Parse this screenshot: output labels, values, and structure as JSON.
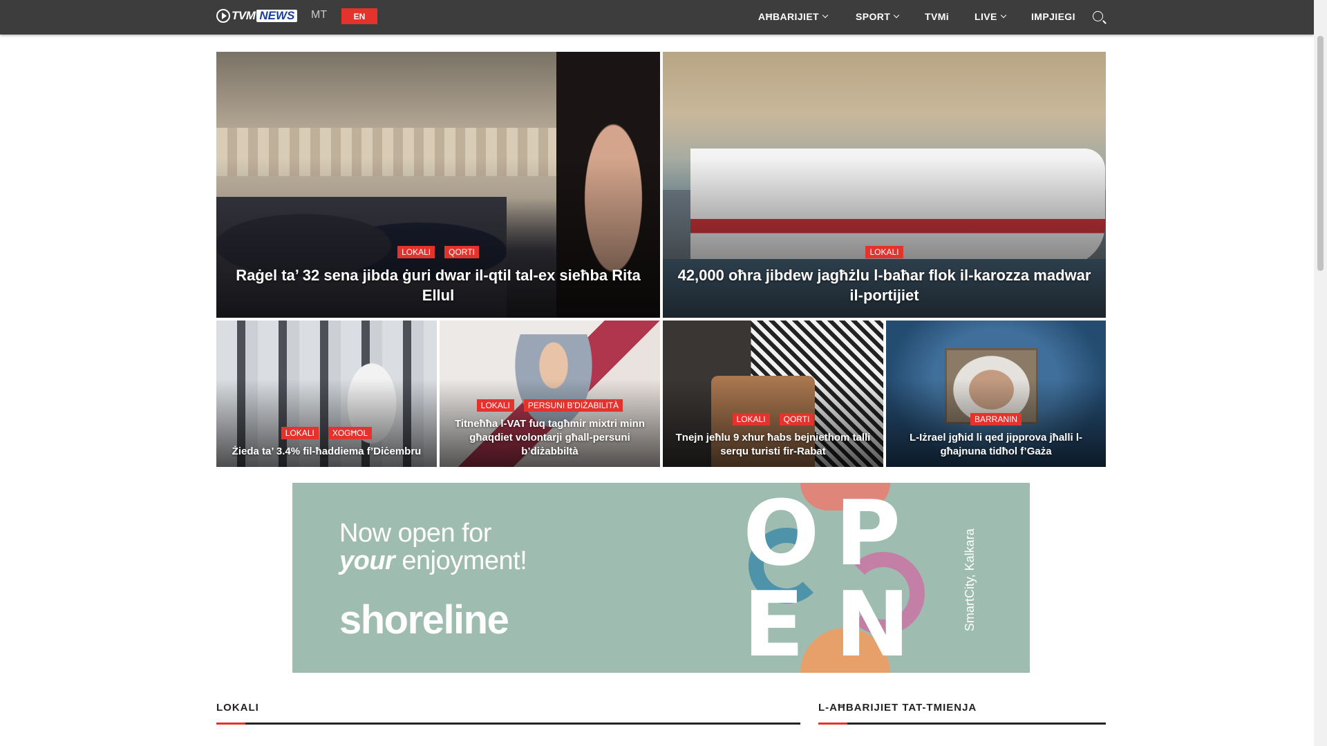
{
  "header": {
    "logo_tvm": "TVM",
    "logo_news": "NEWS",
    "logo_lang": "MT",
    "lang_button": "EN",
    "nav": [
      {
        "label": "AĦBARIJIET",
        "has_menu": true
      },
      {
        "label": "SPORT",
        "has_menu": true
      },
      {
        "label": "TVMi",
        "has_menu": false
      },
      {
        "label": "LIVE",
        "has_menu": true
      },
      {
        "label": "IMPJIEGI",
        "has_menu": false
      }
    ],
    "search_icon": "search-icon"
  },
  "featured": [
    {
      "tags": [
        "LOKALI",
        "QORTI"
      ],
      "title": "Raġel ta’ 32 sena jibda ġuri dwar il-qtil tal-ex sieħba Rita Ellul"
    },
    {
      "tags": [
        "LOKALI"
      ],
      "title": "42,000 oħra jibdew jagħżlu l-baħar flok il-karozza madwar il-portijiet"
    },
    {
      "tags": [
        "LOKALI",
        "XOGĦOL"
      ],
      "title": "Żieda ta’ 3.4% fil-ħaddiema f’Diċembru"
    },
    {
      "tags": [
        "LOKALI",
        "PERSUNI B’DIŻABILITÀ"
      ],
      "title": "Titneħħa l-VAT fuq tagħmir mixtri minn għaqdiet volontarji għall-persuni b’diżabbiltà"
    },
    {
      "tags": [
        "LOKALI",
        "QORTI"
      ],
      "title": "Tnejn jeħlu 9 xhur ħabs bejniethom talli serqu turisti fir-Rabat"
    },
    {
      "tags": [
        "BARRANIN"
      ],
      "title": "L-Iżrael jgħid li qed jipprova jħalli l-għajnuna tidħol f’Gaża"
    }
  ],
  "banner": {
    "line1": "Now open for",
    "line2_bold": "your",
    "line2_rest": " enjoyment!",
    "brand": "shoreline",
    "location": "SmartCity, Kalkara",
    "word": "OPEN"
  },
  "sections": {
    "left": "LOKALI",
    "right": "L-AĦBARIJIET TAT-TMIENJA"
  },
  "colors": {
    "accent": "#e4332d",
    "topbar": "#3d3d3d",
    "banner_bg": "#9fbcb0"
  }
}
